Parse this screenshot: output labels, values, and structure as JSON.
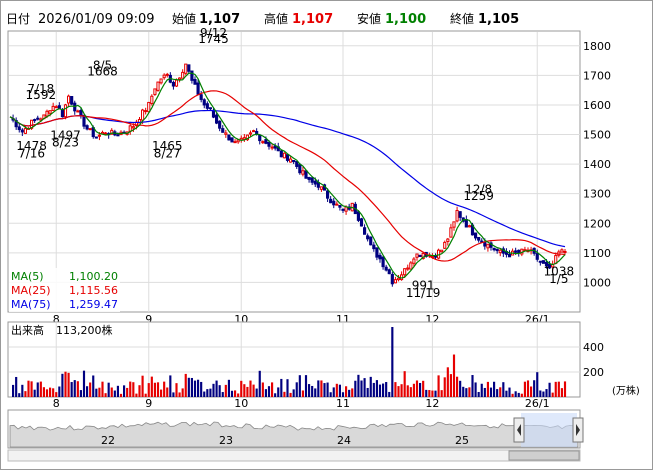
{
  "header": {
    "date_label": "日付",
    "datetime": "2026/01/09 09:09",
    "open_label": "始値",
    "open": "1,107",
    "high_label": "高値",
    "high": "1,107",
    "low_label": "安値",
    "low": "1,100",
    "close_label": "終値",
    "close": "1,105",
    "colors": {
      "high": "#e60000",
      "low": "#008000",
      "label": "#000000"
    }
  },
  "chart_data": [
    {
      "type": "candlestick",
      "ylim": [
        900,
        1850
      ],
      "y_ticks": [
        1000,
        1100,
        1200,
        1300,
        1400,
        1500,
        1600,
        1700,
        1800
      ],
      "x_months": [
        {
          "label": "8",
          "day": 15
        },
        {
          "label": "9",
          "day": 45
        },
        {
          "label": "10",
          "day": 75
        },
        {
          "label": "11",
          "day": 108
        },
        {
          "label": "12",
          "day": 137
        },
        {
          "label": "26/1",
          "day": 171
        }
      ],
      "num_days": 180,
      "anchors": [
        [
          0,
          1560
        ],
        [
          4,
          1510
        ],
        [
          7,
          1540
        ],
        [
          9,
          1555
        ],
        [
          11,
          1560
        ],
        [
          13,
          1590
        ],
        [
          15,
          1600
        ],
        [
          17,
          1568
        ],
        [
          19,
          1630
        ],
        [
          22,
          1570
        ],
        [
          25,
          1520
        ],
        [
          28,
          1490
        ],
        [
          31,
          1510
        ],
        [
          34,
          1500
        ],
        [
          37,
          1510
        ],
        [
          40,
          1530
        ],
        [
          42,
          1560
        ],
        [
          45,
          1600
        ],
        [
          47,
          1660
        ],
        [
          49,
          1690
        ],
        [
          51,
          1700
        ],
        [
          53,
          1670
        ],
        [
          55,
          1700
        ],
        [
          57,
          1740
        ],
        [
          59,
          1680
        ],
        [
          61,
          1640
        ],
        [
          63,
          1600
        ],
        [
          65,
          1580
        ],
        [
          67,
          1540
        ],
        [
          70,
          1500
        ],
        [
          73,
          1470
        ],
        [
          76,
          1480
        ],
        [
          79,
          1510
        ],
        [
          82,
          1480
        ],
        [
          85,
          1460
        ],
        [
          88,
          1430
        ],
        [
          91,
          1420
        ],
        [
          94,
          1380
        ],
        [
          97,
          1340
        ],
        [
          100,
          1330
        ],
        [
          103,
          1290
        ],
        [
          106,
          1260
        ],
        [
          108,
          1240
        ],
        [
          111,
          1260
        ],
        [
          114,
          1200
        ],
        [
          117,
          1120
        ],
        [
          120,
          1080
        ],
        [
          123,
          1030
        ],
        [
          124,
          1005
        ],
        [
          126,
          1020
        ],
        [
          128,
          1040
        ],
        [
          131,
          1090
        ],
        [
          134,
          1100
        ],
        [
          137,
          1090
        ],
        [
          140,
          1110
        ],
        [
          142,
          1150
        ],
        [
          144,
          1200
        ],
        [
          145,
          1240
        ],
        [
          147,
          1210
        ],
        [
          150,
          1170
        ],
        [
          153,
          1140
        ],
        [
          156,
          1120
        ],
        [
          159,
          1100
        ],
        [
          162,
          1095
        ],
        [
          165,
          1100
        ],
        [
          168,
          1110
        ],
        [
          171,
          1080
        ],
        [
          174,
          1050
        ],
        [
          175,
          1040
        ],
        [
          178,
          1100
        ],
        [
          180,
          1106
        ]
      ],
      "volume_ylim": [
        0,
        600
      ],
      "volume_ticks": [
        200,
        400
      ],
      "volume_unit": "(万株)",
      "volume_label": "出来高",
      "volume_value": "113,200株",
      "annotations": [
        {
          "text": "7/18",
          "day": 10,
          "value": 1640
        },
        {
          "text": "1592",
          "day": 10,
          "value": 1620
        },
        {
          "text": "8/5",
          "day": 30,
          "value": 1720
        },
        {
          "text": "1668",
          "day": 30,
          "value": 1700
        },
        {
          "text": "9/12",
          "day": 66,
          "value": 1830
        },
        {
          "text": "1745",
          "day": 66,
          "value": 1810
        },
        {
          "text": "1497",
          "day": 18,
          "value": 1484
        },
        {
          "text": "1478",
          "day": 7,
          "value": 1448
        },
        {
          "text": "8/23",
          "day": 18,
          "value": 1460
        },
        {
          "text": "7/16",
          "day": 7,
          "value": 1423
        },
        {
          "text": "1465",
          "day": 51,
          "value": 1448
        },
        {
          "text": "8/27",
          "day": 51,
          "value": 1423
        },
        {
          "text": "12/8",
          "day": 152,
          "value": 1300
        },
        {
          "text": "1259",
          "day": 152,
          "value": 1278
        },
        {
          "text": "991",
          "day": 134,
          "value": 976
        },
        {
          "text": "11/19",
          "day": 134,
          "value": 951
        },
        {
          "text": "1038",
          "day": 178,
          "value": 1023
        },
        {
          "text": "1/5",
          "day": 178,
          "value": 998
        }
      ],
      "legend": [
        {
          "name": "MA(5)",
          "value": "1,100.20",
          "color": "#008000"
        },
        {
          "name": "MA(25)",
          "value": "1,115.56",
          "color": "#e60000"
        },
        {
          "name": "MA(75)",
          "value": "1,259.47",
          "color": "#0000e6"
        }
      ],
      "colors": {
        "up": "#e60000",
        "down": "#000080",
        "ma5": "#008000",
        "ma25": "#e60000",
        "ma75": "#0000e6"
      }
    },
    {
      "type": "area",
      "role": "navigator",
      "x_ticks": [
        "22",
        "23",
        "24",
        "25"
      ]
    }
  ]
}
